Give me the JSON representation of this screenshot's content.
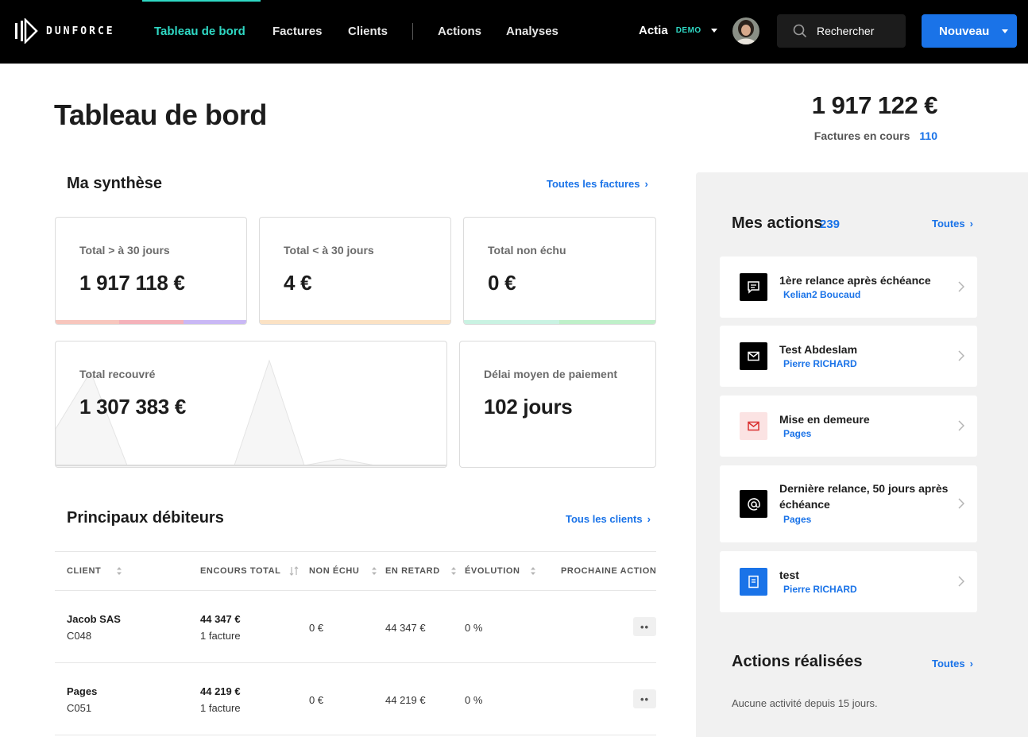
{
  "nav": {
    "brand": "DUNFORCE",
    "links": [
      {
        "label": "Tableau de bord",
        "active": true
      },
      {
        "label": "Factures",
        "active": false
      },
      {
        "label": "Clients",
        "active": false
      },
      {
        "label": "Actions",
        "active": false
      },
      {
        "label": "Analyses",
        "active": false
      }
    ],
    "account_name": "Actia",
    "account_badge": "DEMO",
    "search_placeholder": "Rechercher",
    "new_button": "Nouveau"
  },
  "colors": {
    "accent": "#2fd8c4",
    "primary": "#1a73e8",
    "nav_bg": "#000000",
    "panel_bg": "#f1f1f1"
  },
  "page": {
    "title": "Tableau de bord",
    "grand_total": "1 917 122 €",
    "open_invoices_label": "Factures en cours",
    "open_invoices_count": "110"
  },
  "synthesis": {
    "title": "Ma synthèse",
    "link": "Toutes les factures",
    "cards": [
      {
        "label": "Total > à 30 jours",
        "value": "1 917 118 €"
      },
      {
        "label": "Total < à 30 jours",
        "value": "4 €"
      },
      {
        "label": "Total non échu",
        "value": "0 €"
      },
      {
        "label": "Total recouvré",
        "value": "1 307 383 €"
      },
      {
        "label": "Délai moyen de paiement",
        "value": "102 jours"
      }
    ]
  },
  "debtors": {
    "title": "Principaux débiteurs",
    "link": "Tous les clients",
    "columns": [
      "CLIENT",
      "ENCOURS TOTAL",
      "NON ÉCHU",
      "EN RETARD",
      "ÉVOLUTION",
      "PROCHAINE ACTION"
    ],
    "rows": [
      {
        "name": "Jacob SAS",
        "code": "C048",
        "total": "44 347 €",
        "invoices": "1 facture",
        "not_due": "0 €",
        "late": "44 347 €",
        "evolution": "0 %",
        "more": "••"
      },
      {
        "name": "Pages",
        "code": "C051",
        "total": "44 219 €",
        "invoices": "1 facture",
        "not_due": "0 €",
        "late": "44 219 €",
        "evolution": "0 %",
        "more": "••"
      }
    ]
  },
  "actions": {
    "title": "Mes actions",
    "count": "239",
    "link": "Toutes",
    "items": [
      {
        "title": "1ère relance après échéance",
        "contact": "Kelian2 Boucaud",
        "icon": "chat-icon"
      },
      {
        "title": "Test Abdeslam",
        "contact": "Pierre RICHARD",
        "icon": "mail-icon"
      },
      {
        "title": "Mise en demeure",
        "contact": "Pages",
        "icon": "mail-red-icon"
      },
      {
        "title": "Dernière relance, 50 jours après échéance",
        "contact": "Pages",
        "icon": "at-icon"
      },
      {
        "title": "test",
        "contact": "Pierre RICHARD",
        "icon": "document-icon"
      }
    ]
  },
  "done": {
    "title": "Actions réalisées",
    "link": "Toutes",
    "empty": "Aucune activité depuis 15 jours."
  }
}
